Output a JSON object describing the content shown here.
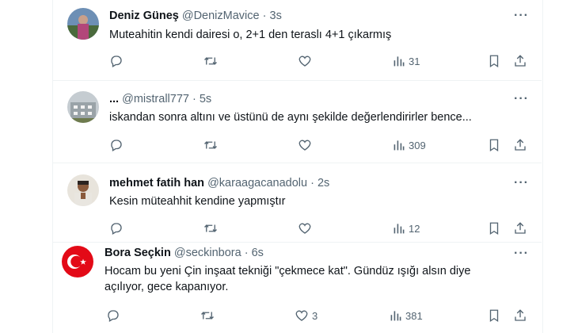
{
  "tweets": [
    {
      "name": "Deniz Güneş",
      "handle": "@DenizMavice",
      "dot": "·",
      "time": "3s",
      "more": "···",
      "text": "Muteahitin kendi dairesi o, 2+1 den teraslı 4+1 çıkarmış",
      "replies": "",
      "retweets": "",
      "likes": "",
      "views": "31"
    },
    {
      "name": "...",
      "handle": "@mistrall777",
      "dot": "·",
      "time": "5s",
      "more": "···",
      "text": "iskandan sonra altını ve üstünü de aynı şekilde değerlendirirler bence...",
      "replies": "",
      "retweets": "",
      "likes": "",
      "views": "309"
    },
    {
      "name": "mehmet fatih han",
      "handle": "@karaagacanadolu",
      "dot": "·",
      "time": "2s",
      "more": "···",
      "text": "Kesin müteahhit kendine yapmıştır",
      "replies": "",
      "retweets": "",
      "likes": "",
      "views": "12"
    },
    {
      "name": "Bora Seçkin",
      "handle": "@seckinbora",
      "dot": "·",
      "time": "6s",
      "more": "···",
      "text_line1": "Hocam bu yeni Çin inşaat tekniği \"çekmece kat\". Gündüz ışığı alsın diye",
      "text_line2": "açılıyor, gece kapanıyor.",
      "replies": "",
      "retweets": "",
      "likes": "3",
      "views": "381"
    }
  ],
  "icons": {
    "reply": "reply-icon",
    "retweet": "retweet-icon",
    "like": "heart-icon",
    "views": "views-icon",
    "bookmark": "bookmark-icon",
    "share": "share-icon",
    "more": "more-icon"
  },
  "colors": {
    "text": "#0f1419",
    "secondary": "#536471",
    "border": "#eff3f4"
  }
}
